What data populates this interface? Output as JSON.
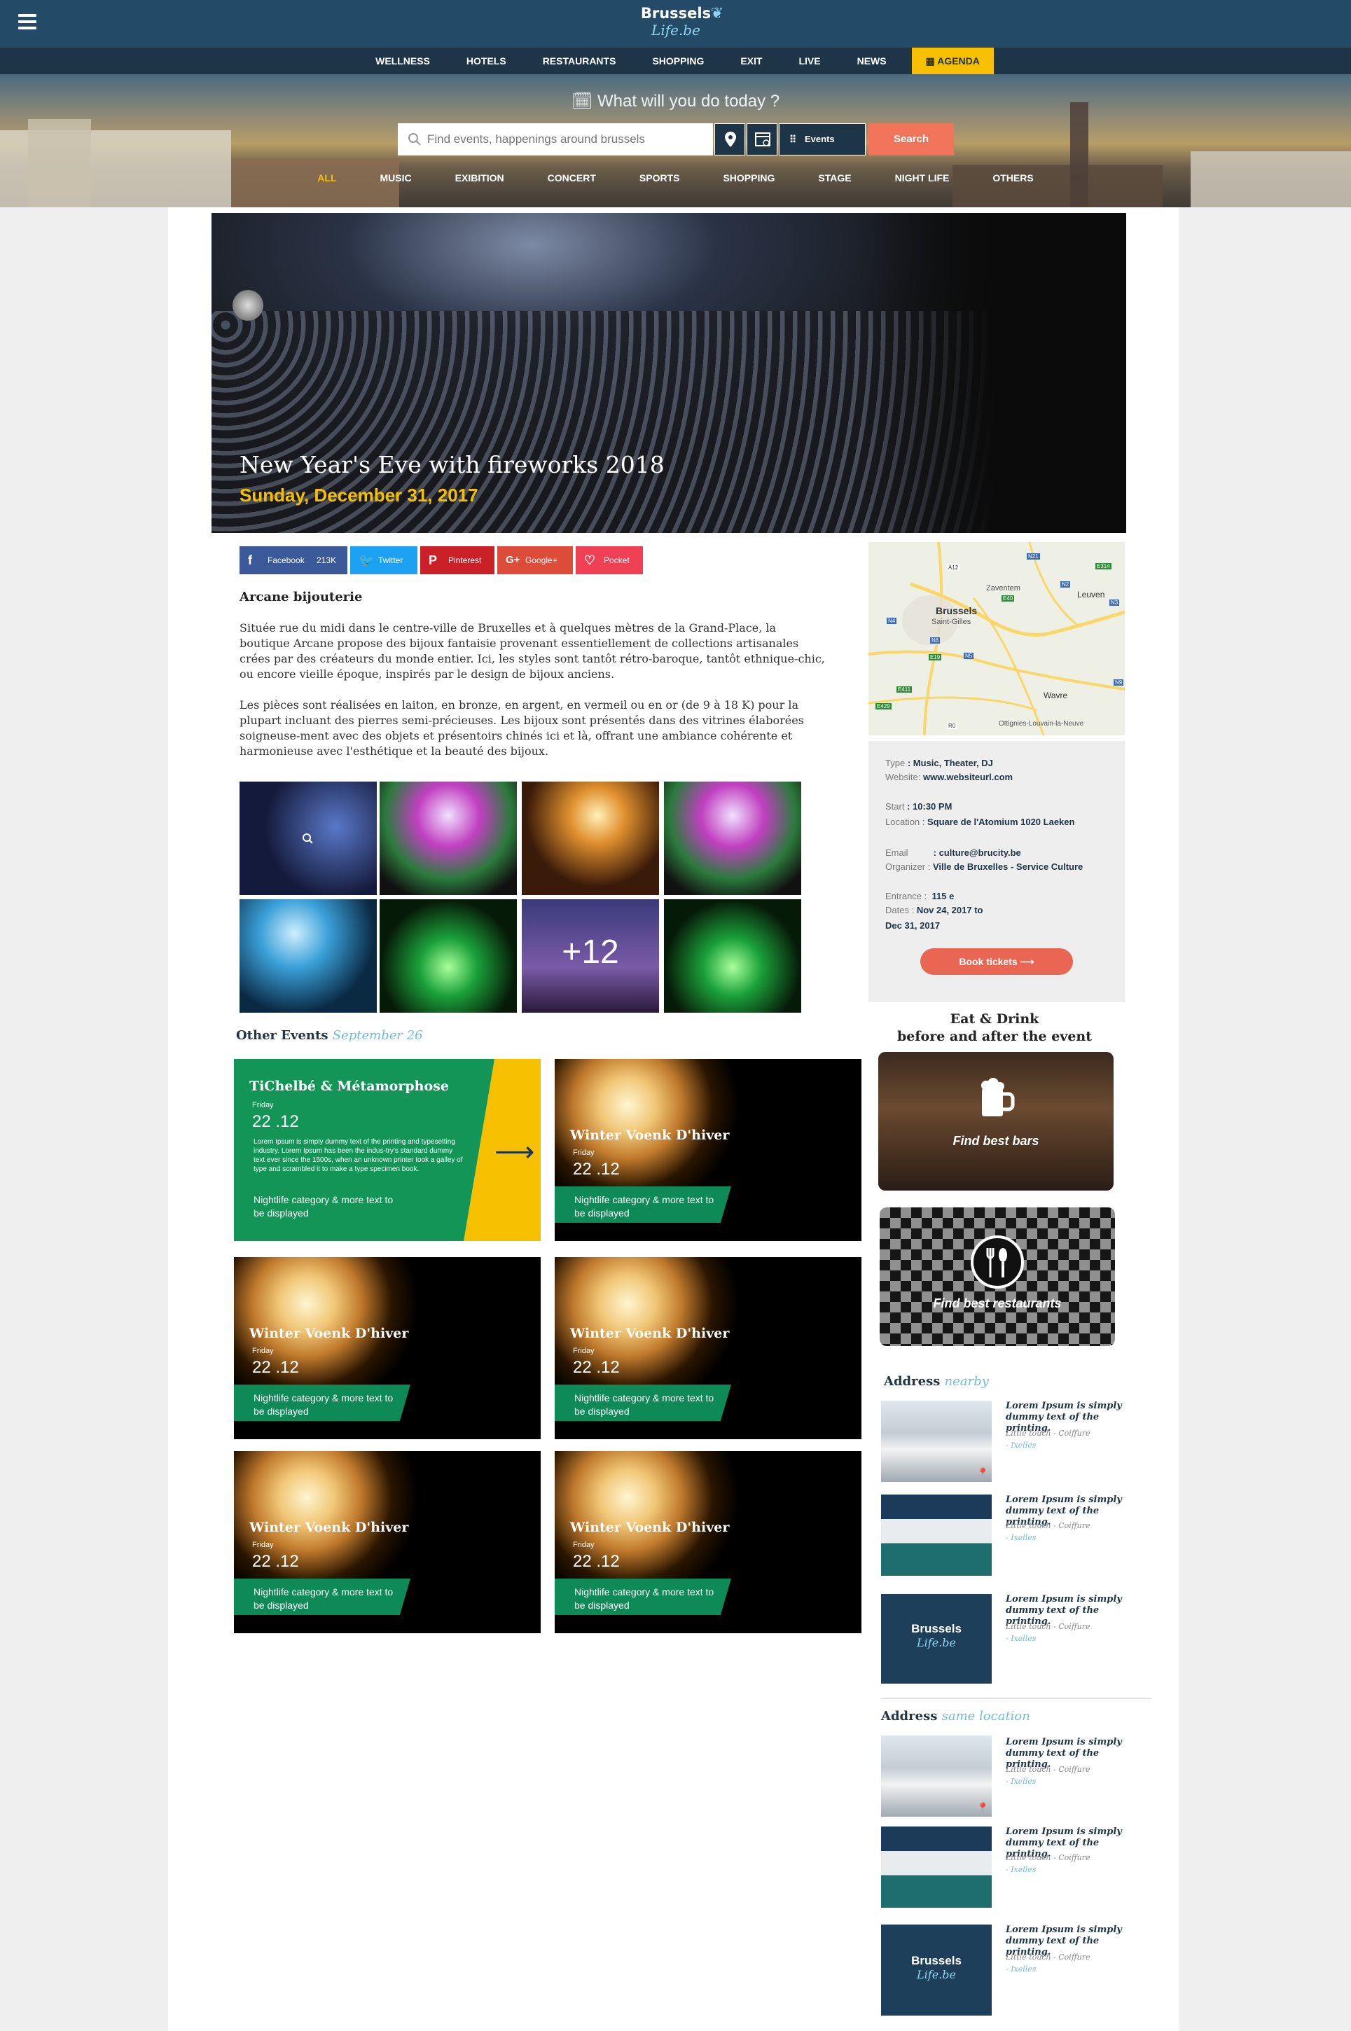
{
  "header": {
    "logo_line1": "Brussels",
    "logo_line2": "Life.be"
  },
  "nav": [
    "WELLNESS",
    "HOTELS",
    "RESTAURANTS",
    "SHOPPING",
    "EXIT",
    "LIVE",
    "NEWS"
  ],
  "nav_agenda": "AGENDA",
  "hero": {
    "question": "What will you do today ?",
    "search_placeholder": "Find events, happenings around brussels",
    "type_select": "Events",
    "search_button": "Search",
    "categories": [
      "ALL",
      "MUSIC",
      "EXIBITION",
      "CONCERT",
      "SPORTS",
      "SHOPPING",
      "STAGE",
      "NIGHT LIFE",
      "OTHERS"
    ],
    "active_category": "ALL"
  },
  "event": {
    "title": "New Year's Eve with fireworks 2018",
    "date": "Sunday, December 31, 2017"
  },
  "share": [
    {
      "label": "Facebook",
      "count": "213K",
      "icon": "facebook-icon",
      "color": "#3b5998"
    },
    {
      "label": "Twitter",
      "icon": "twitter-icon",
      "color": "#1da1f2"
    },
    {
      "label": "Pinterest",
      "icon": "pinterest-icon",
      "color": "#cb2027"
    },
    {
      "label": "Google+",
      "icon": "google-plus-icon",
      "color": "#dd4b39"
    },
    {
      "label": "Pocket",
      "icon": "pocket-icon",
      "color": "#ef4056"
    }
  ],
  "article": {
    "title": "Arcane bijouterie",
    "p1": "Située rue du midi dans le centre-ville de Bruxelles et à quelques mètres de la Grand-Place, la boutique Arcane propose des bijoux fantaisie provenant essentiellement de collections artisanales crées par des créateurs du monde entier. Ici, les styles sont tantôt rétro-baroque, tantôt ethnique-chic, ou encore vieille époque, inspirés par le design de bijoux anciens.",
    "p2": "Les pièces sont réalisées en laiton, en bronze, en argent, en vermeil ou en or (de 9 à 18 K) pour la plupart incluant des pierres semi-précieuses. Les bijoux sont présentés dans des vitrines élaborées soigneuse-ment avec des objets et présentoirs chinés ici et là, offrant une ambiance cohérente et harmonieuse avec l'esthétique et la beauté des bijoux."
  },
  "gallery": {
    "more": "+12"
  },
  "map": {
    "labels": [
      "Brussels",
      "Saint-Gilles",
      "Zaventem",
      "Leuven",
      "Wavre",
      "Ottignies-Louvain-la-Neuve"
    ],
    "roads": [
      "A12",
      "N21",
      "E314",
      "N2",
      "N3",
      "E40",
      "E19",
      "N6",
      "N5",
      "N4",
      "E429",
      "R0",
      "E411",
      "N9"
    ]
  },
  "info": {
    "type_label": "Type",
    "type": ": Music, Theater, DJ",
    "website_label": "Website:",
    "website": "www.websiteurl.com",
    "start_label": "Start",
    "start": ": 10:30 PM",
    "location_label": "Location :",
    "location": "Square de l'Atomium 1020 Laeken",
    "email_label": "Email",
    "email": ": culture@brucity.be",
    "organizer_label": "Organizer :",
    "organizer": "Ville de Bruxelles - Service Culture",
    "entrance_label": "Entrance :",
    "entrance": "115 e",
    "dates_label": "Dates :",
    "dates1": "Nov 24, 2017 to",
    "dates2": "Dec 31, 2017",
    "book": "Book tickets"
  },
  "other_events": {
    "title": "Other Events",
    "subtitle": "September 26",
    "featured": {
      "title": "TiChelbé & Métamorphose",
      "day": "Friday",
      "date": "22 .12",
      "desc": "Lorem Ipsum is simply dummy text of the printing and typesetting industry. Lorem Ipsum has been the indus-try's standard dummy text ever since the 1500s, when an unknown printer took a galley of type and scrambled it to make a type specimen book.",
      "category": "Nightlife category & more text to be displayed"
    },
    "cards": [
      {
        "title": "Winter Voenk D'hiver",
        "day": "Friday",
        "date": "22 .12",
        "category": "Nightlife category & more text to be displayed"
      },
      {
        "title": "Winter Voenk D'hiver",
        "day": "Friday",
        "date": "22 .12",
        "category": "Nightlife category & more text to be displayed"
      },
      {
        "title": "Winter Voenk D'hiver",
        "day": "Friday",
        "date": "22 .12",
        "category": "Nightlife category & more text to be displayed"
      },
      {
        "title": "Winter Voenk D'hiver",
        "day": "Friday",
        "date": "22 .12",
        "category": "Nightlife category & more text to be displayed"
      },
      {
        "title": "Winter Voenk D'hiver",
        "day": "Friday",
        "date": "22 .12",
        "category": "Nightlife category & more text to be displayed"
      }
    ]
  },
  "eat_drink": {
    "title1": "Eat & Drink",
    "title2": "before and after the event",
    "bars": "Find best bars",
    "restaurants": "Find best restaurants"
  },
  "address_nearby": {
    "title": "Address",
    "subtitle": "nearby",
    "items": [
      {
        "title": "Lorem Ipsum is simply dummy text of  the printing.",
        "sub": "Little touch - Coiffure",
        "loc": "- Ixelles"
      },
      {
        "title": "Lorem Ipsum is simply dummy text of  the printing.",
        "sub": "Little touch - Coiffure",
        "loc": "- Ixelles"
      },
      {
        "title": "Lorem Ipsum is simply dummy text of the printing.",
        "sub": "Little touch - Coiffure",
        "loc": "- Ixelles"
      }
    ]
  },
  "address_same": {
    "title": "Address",
    "subtitle": "same location",
    "items": [
      {
        "title": "Lorem Ipsum is simply dummy text of  the printing.",
        "sub": "Little touch - Coiffure",
        "loc": "- Ixelles"
      },
      {
        "title": "Lorem Ipsum is simply dummy text of  the printing.",
        "sub": "Little touch - Coiffure",
        "loc": "- Ixelles"
      },
      {
        "title": "Lorem Ipsum is simply dummy text of the printing.",
        "sub": "Little touch - Coiffure",
        "loc": "- Ixelles"
      }
    ]
  }
}
